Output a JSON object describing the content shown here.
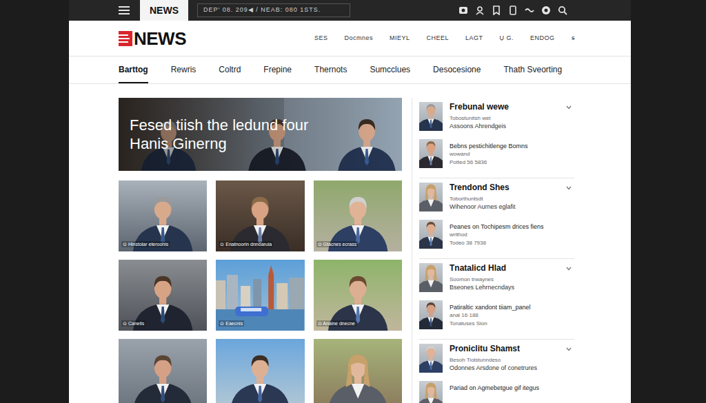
{
  "top_bar": {
    "section_tab": "NEWS",
    "dateline": "DEP' 08. 209◀ / NEAB: 080 1STS."
  },
  "logo": {
    "text": "NEWS"
  },
  "header_links": [
    "SES",
    "Docmnes",
    "MIEYL",
    "CHEEL",
    "LAGT",
    "Ụ G.",
    "ENDOG",
    "ꞩ"
  ],
  "categories": [
    {
      "label": "Barttog",
      "selected": true
    },
    {
      "label": "Rewris",
      "selected": false
    },
    {
      "label": "Coltrd",
      "selected": false
    },
    {
      "label": "Frepine",
      "selected": false
    },
    {
      "label": "Thernots",
      "selected": false
    },
    {
      "label": "Sumcclues",
      "selected": false
    },
    {
      "label": "Desocesione",
      "selected": false
    },
    {
      "label": "Thath Sveorting",
      "selected": false
    }
  ],
  "hero": {
    "headline": "Fesed tiish the ledund four Hanis Ginerng"
  },
  "cards": [
    {
      "kind": "portrait",
      "caption": "⊙ Hinstolar eteroonis"
    },
    {
      "kind": "portrait",
      "caption": "⊙ Enatnoorin dnnoaruia"
    },
    {
      "kind": "portrait",
      "caption": "⊙ Gtacnes ecrass"
    },
    {
      "kind": "portrait",
      "caption": "⊙ Canelis"
    },
    {
      "kind": "scene",
      "caption": "⊙ Eaecnis"
    },
    {
      "kind": "portrait",
      "caption": "⊙ Anaine dnecne"
    },
    {
      "kind": "portrait"
    },
    {
      "kind": "portrait"
    },
    {
      "kind": "portrait"
    }
  ],
  "sidebar": {
    "groups": [
      {
        "title": "Frebunal wewe",
        "subtitle": "Tobostunitsh wet",
        "byline": "Assoons Ahrendgeis",
        "story": {
          "title": "Bebns pestichitlenge Bomns",
          "subtitle": "wowand",
          "meta": "Potted 56 5836"
        }
      },
      {
        "title": "Trendond Shes",
        "subtitle": "Toborthuntsdt",
        "byline": "Wihenoor Aurnes eglafit",
        "story": {
          "title": "Peanes on Tochipesm drices fiens",
          "subtitle": "writhod",
          "meta": "Todeo 38 7938"
        }
      },
      {
        "title": "Tnatalicd Hlad",
        "subtitle": "Soomon trwaynes",
        "byline": "Bseones Lehrnecndays",
        "story": {
          "title": "Patiraltic xandont tiiam_panel",
          "subtitle": "anal 16 188",
          "meta": "Tonatuses Sion"
        }
      },
      {
        "title": "Proniclitu Shamst",
        "subtitle": "Besoh Tiolstunndeso",
        "byline": "Odonnes Arsdone of conetrures",
        "story": {
          "title": "Pariad on Agmebetgue gif itegus"
        }
      }
    ]
  }
}
